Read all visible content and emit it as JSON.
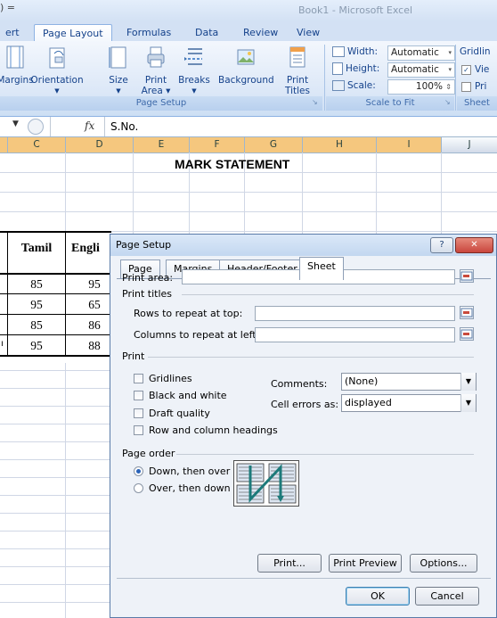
{
  "window": {
    "title": "Book1 - Microsoft Excel",
    "qat_glyphs": ") ="
  },
  "tabs": [
    "ert",
    "Page Layout",
    "Formulas",
    "Data",
    "Review",
    "View"
  ],
  "active_tab": "Page Layout",
  "ribbon": {
    "page_setup": {
      "buttons": [
        "Margins",
        "Orientation",
        "Size",
        "Print Area",
        "Breaks",
        "Background",
        "Print Titles"
      ],
      "group_label": "Page Setup"
    },
    "scale_to_fit": {
      "width_label": "Width:",
      "width_value": "Automatic",
      "height_label": "Height:",
      "height_value": "Automatic",
      "scale_label": "Scale:",
      "scale_value": "100%",
      "group_label": "Scale to Fit"
    },
    "sheet_options": {
      "gridlines_label": "Gridlin",
      "view_label": "Vie",
      "print_label": "Pri",
      "group_label": "Sheet"
    }
  },
  "formula_bar": {
    "fx": "fx",
    "content": "S.No."
  },
  "columns": [
    "C",
    "D",
    "E",
    "F",
    "G",
    "H",
    "I",
    "J"
  ],
  "sheet": {
    "title": "MARK STATEMENT",
    "headers": [
      "Tamil",
      "Engli"
    ],
    "rows": [
      [
        "85",
        "95"
      ],
      [
        "95",
        "65"
      ],
      [
        "85",
        "86"
      ],
      [
        "95",
        "88"
      ]
    ],
    "row4_left_fragment": "ı"
  },
  "dialog": {
    "title": "Page Setup",
    "help_glyph": "?",
    "close_glyph": "✕",
    "tabs": [
      "Page",
      "Margins",
      "Header/Footer",
      "Sheet"
    ],
    "active_tab": "Sheet",
    "print_area_label": "Print area:",
    "print_area_value": "",
    "print_titles_label": "Print titles",
    "rows_repeat_label": "Rows to repeat at top:",
    "rows_repeat_value": "",
    "cols_repeat_label": "Columns to repeat at left:",
    "cols_repeat_value": "",
    "print_section_label": "Print",
    "checkboxes": [
      {
        "label": "Gridlines",
        "checked": false
      },
      {
        "label": "Black and white",
        "checked": false
      },
      {
        "label": "Draft quality",
        "checked": false
      },
      {
        "label": "Row and column headings",
        "checked": false
      }
    ],
    "comments_label": "Comments:",
    "comments_value": "(None)",
    "cell_errors_label": "Cell errors as:",
    "cell_errors_value": "displayed",
    "page_order_label": "Page order",
    "page_order_options": [
      {
        "label": "Down, then over",
        "selected": true
      },
      {
        "label": "Over, then down",
        "selected": false
      }
    ],
    "buttons": {
      "print": "Print...",
      "preview": "Print Preview",
      "options": "Options...",
      "ok": "OK",
      "cancel": "Cancel"
    }
  },
  "colors": {
    "ribbon_text": "#15428b",
    "dialog_bg": "#eef2f8",
    "close_red": "#c9463d",
    "arrow_teal": "#1c7a7a"
  }
}
